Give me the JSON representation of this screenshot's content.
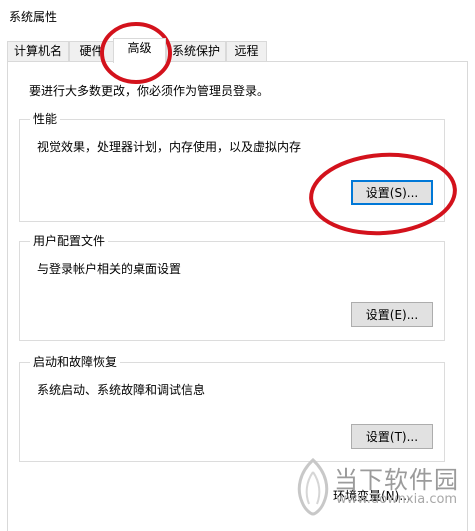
{
  "window": {
    "title": "系统属性"
  },
  "tabs": [
    {
      "label": "计算机名"
    },
    {
      "label": "硬件"
    },
    {
      "label": "高级"
    },
    {
      "label": "系统保护"
    },
    {
      "label": "远程"
    }
  ],
  "notice": "要进行大多数更改，你必须作为管理员登录。",
  "performance": {
    "legend": "性能",
    "description": "视觉效果，处理器计划，内存使用，以及虚拟内存",
    "settings_button": "设置(S)..."
  },
  "user_profiles": {
    "legend": "用户配置文件",
    "description": "与登录帐户相关的桌面设置",
    "settings_button": "设置(E)..."
  },
  "startup_recovery": {
    "legend": "启动和故障恢复",
    "description": "系统启动、系统故障和调试信息",
    "settings_button": "设置(T)..."
  },
  "env_vars_button": "环境变量(N)...",
  "watermark": {
    "text": "当下软件园",
    "url": "www.downxia.com"
  },
  "annotation_color": "#d3121c",
  "accent_color": "#0078d7"
}
